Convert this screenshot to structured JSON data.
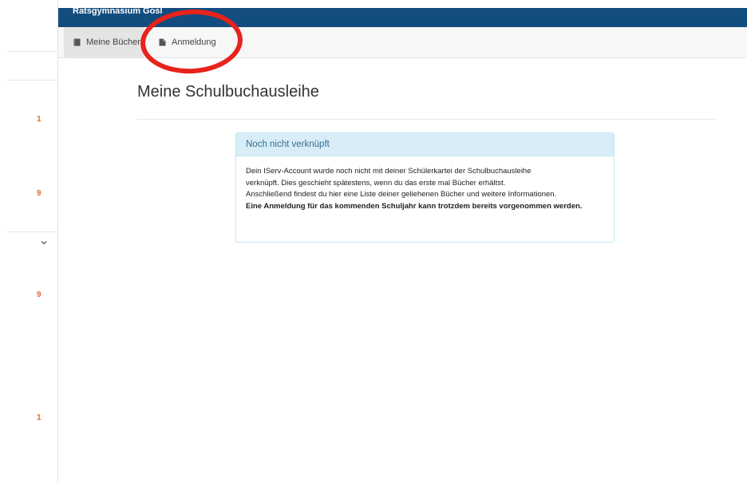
{
  "header": {
    "school_name": "Ratsgymnasium Gosl"
  },
  "tabs": [
    {
      "label": "Meine Bücher",
      "icon": "book-icon",
      "active": true
    },
    {
      "label": "Anmeldung",
      "icon": "file-icon",
      "active": false
    }
  ],
  "sidebar": {
    "counts": [
      "1",
      "9",
      "9",
      "1"
    ]
  },
  "main": {
    "title": "Meine Schulbuchausleihe",
    "panel": {
      "heading": "Noch nicht verknüpft",
      "line1": "Dein IServ-Account wurde noch nicht mit deiner Schülerkartei der Schulbuchausleihe",
      "line2": "verknüpft. Dies geschieht spätestens, wenn du das erste mal Bücher erhältst.",
      "line3": "Anschließend findest du hier eine Liste deiner geliehenen Bücher und weitere Informationen.",
      "bold_text": "Eine Anmeldung für das kommenden Schuljahr kann trotzdem bereits vorgenommen werden."
    }
  },
  "colors": {
    "header_blue": "#134c7f",
    "count_orange": "#e8662f",
    "panel_heading_bg": "#d9edf7",
    "panel_heading_text": "#31708f",
    "annotation_red": "#e8231c"
  }
}
